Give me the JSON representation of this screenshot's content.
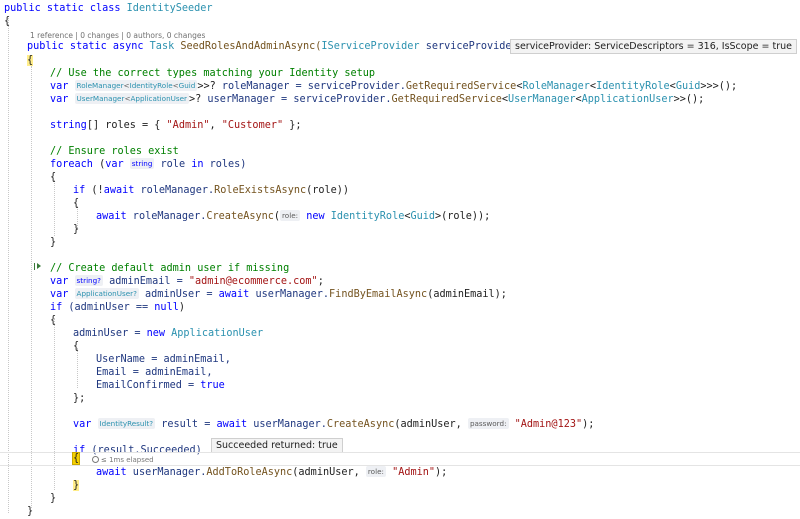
{
  "code": {
    "class_decl": {
      "kw": "public static class ",
      "name": "IdentitySeeder"
    },
    "open_brace": "{",
    "codelens": "1 reference | 0 changes | 0 authors, 0 changes",
    "method_decl": {
      "kw": "public static async ",
      "ret": "Task",
      "name": " SeedRolesAndAdminAsync(",
      "ptype": "IServiceProvider",
      "pname": " serviceProvider)"
    },
    "param_tip": "serviceProvider: ServiceDescriptors = 316, IsScope = true",
    "method_open": "{",
    "c1": "// Use the correct types matching your Identity setup",
    "l_rm": {
      "var": "var",
      "hint_a": "RoleManager",
      "hint_b": "<",
      "hint_c": "IdentityRole",
      "hint_d": "<",
      "hint_e": "Guid",
      "hint_f": ">>?",
      "rest_a": " roleManager = ",
      "rest_b": "serviceProvider.",
      "rest_c": "GetRequiredService",
      "rest_d": "<",
      "rest_e": "RoleManager",
      "rest_f": "<",
      "rest_g": "IdentityRole",
      "rest_h": "<",
      "rest_i": "Guid",
      "rest_j": ">>>();"
    },
    "l_um": {
      "var": "var",
      "hint_a": "UserManager",
      "hint_b": "<",
      "hint_c": "ApplicationUser",
      "hint_d": ">?",
      "rest_a": " userManager = ",
      "rest_b": "serviceProvider.",
      "rest_c": "GetRequiredService",
      "rest_d": "<",
      "rest_e": "UserManager",
      "rest_f": "<",
      "rest_g": "ApplicationUser",
      "rest_h": ">>();"
    },
    "l_roles": {
      "kw": "string",
      "a": "[] roles = { ",
      "s1": "\"Admin\"",
      "b": ", ",
      "s2": "\"Customer\"",
      "c": " };"
    },
    "c2": "// Ensure roles exist",
    "l_foreach": {
      "kw": "foreach",
      "a": " (",
      "var": "var",
      "hint": "string",
      "b": " role ",
      "in": "in",
      "c": " roles)"
    },
    "brace_open": "{",
    "brace_close": "}",
    "l_if1": {
      "kw": "if",
      "a": " (!",
      "aw": "await",
      "b": " roleManager.",
      "fn": "RoleExistsAsync",
      "c": "(role))"
    },
    "l_create_role": {
      "aw": "await",
      "a": " roleManager.",
      "fn": "CreateAsync",
      "b": "(",
      "hint": "role:",
      "nw": " new ",
      "ty": "IdentityRole",
      "c": "<",
      "ty2": "Guid",
      "d": ">(role));"
    },
    "c3": "// Create default admin user if missing",
    "l_email": {
      "var": "var",
      "hint": "string?",
      "a": " adminEmail = ",
      "s": "\"admin@ecommerce.com\"",
      "b": ";"
    },
    "l_admin": {
      "var": "var",
      "hint": "ApplicationUser?",
      "a": " adminUser = ",
      "aw": "await",
      "b": " userManager.",
      "fn": "FindByEmailAsync",
      "c": "(adminEmail);"
    },
    "l_if2": {
      "kw": "if",
      "a": " (adminUser == ",
      "nl": "null",
      "b": ")"
    },
    "l_new": {
      "a": "adminUser = ",
      "nw": "new",
      "b": " ",
      "ty": "ApplicationUser"
    },
    "l_username": "UserName = adminEmail,",
    "l_mail": "Email = adminEmail,",
    "l_confirmed": {
      "a": "EmailConfirmed = ",
      "kw": "true"
    },
    "brace_close_semi": "};",
    "l_result": {
      "var": "var",
      "hint": "IdentityResult?",
      "a": " result = ",
      "aw": "await",
      "b": " userManager.",
      "fn": "CreateAsync",
      "c": "(adminUser, ",
      "hint2": "password:",
      "s": " \"Admin@123\"",
      "d": ");"
    },
    "l_if3": {
      "kw": "if",
      "a": " (result.",
      "b": "Succeeded)"
    },
    "succeeded_tip": "Succeeded returned: true",
    "elapsed": "≤ 1ms elapsed",
    "l_addrole": {
      "aw": "await",
      "a": " userManager.",
      "fn": "AddToRoleAsync",
      "b": "(adminUser, ",
      "hint": "role:",
      "s": " \"Admin\"",
      "c": ");"
    }
  },
  "colors": {
    "keyword": "#0000ff",
    "type": "#2b91af",
    "comment": "#008000",
    "string": "#a31515",
    "method": "#74531f",
    "brace_highlight": "#f5d000"
  },
  "icons": {
    "gutter_run": "run-to-cursor-icon",
    "elapsed": "stopwatch-icon"
  }
}
